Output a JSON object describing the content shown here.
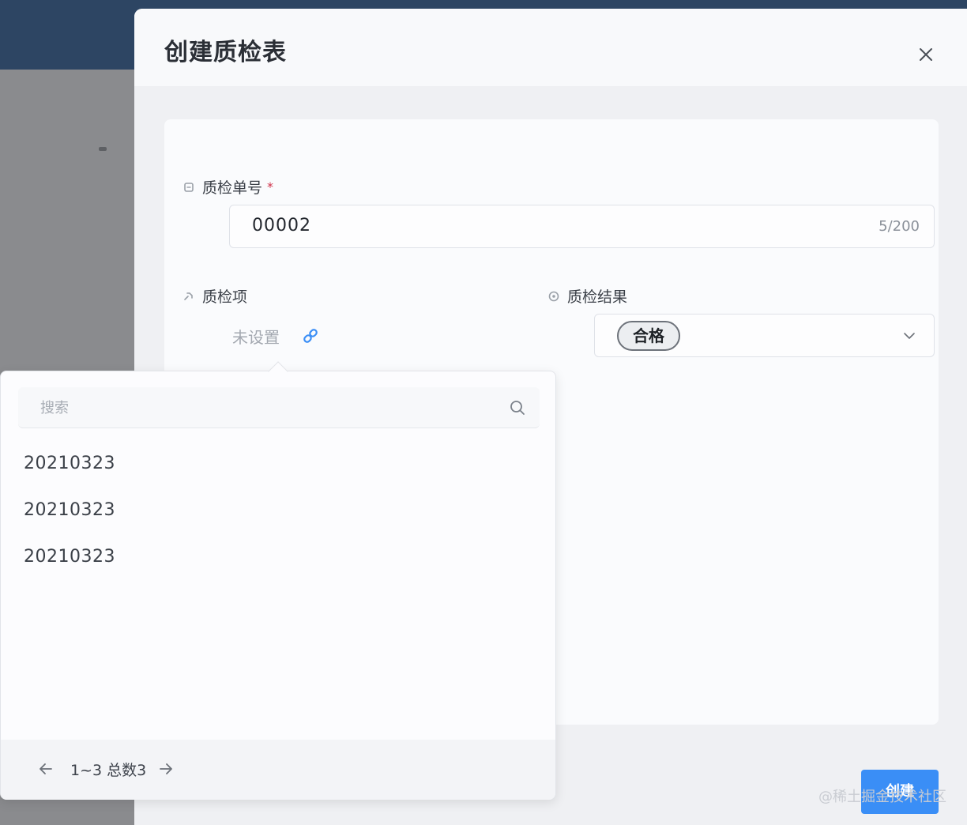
{
  "modal": {
    "title": "创建质检表"
  },
  "fields": {
    "inspection_no": {
      "label": "质检单号",
      "required": "*",
      "value": "00002",
      "char_count": "5/200"
    },
    "inspection_item": {
      "label": "质检项",
      "value": "未设置"
    },
    "inspection_result": {
      "label": "质检结果",
      "selected": "合格"
    }
  },
  "dropdown": {
    "search_placeholder": "搜索",
    "items": [
      "20210323",
      "20210323",
      "20210323"
    ],
    "pagination": "1~3 总数3"
  },
  "footer": {
    "create_label": "创建"
  },
  "watermark": "@稀土掘金技术社区",
  "colors": {
    "accent": "#3a8ef6",
    "topbar": "#2d4563",
    "required": "#d0324a"
  }
}
